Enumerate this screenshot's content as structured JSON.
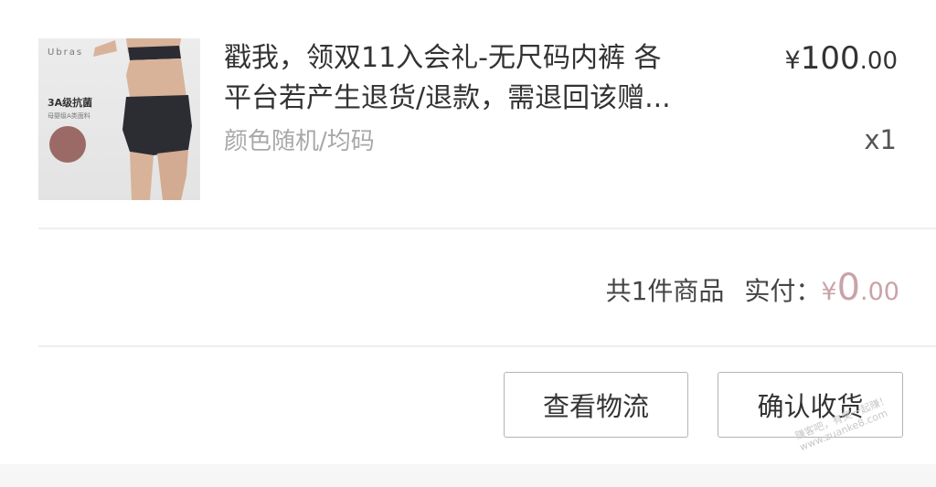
{
  "product": {
    "image": {
      "brand": "Ubras",
      "tag": "3A级抗菌",
      "tag_sub": "母婴级A类面料"
    },
    "title_line1": "戳我，领双11入会礼-无尺码内裤 各",
    "title_line2": "平台若产生退货/退款，需退回该赠...",
    "variant": "颜色随机/均码",
    "price": {
      "currency": "¥",
      "integer": "100",
      "decimal": ".00"
    },
    "quantity": "x1"
  },
  "summary": {
    "count_text": "共1件商品",
    "paid_label": "实付：",
    "amount": {
      "currency": "¥",
      "integer": "0",
      "decimal": ".00"
    }
  },
  "actions": {
    "logistics_label": "查看物流",
    "confirm_label": "确认收货"
  },
  "watermark": {
    "line1": "赚客吧，有奖一起赚！",
    "line2": "www.zuanke8.com"
  },
  "colors": {
    "amount": "#c9a3a8",
    "text": "#333333",
    "muted": "#a8a8a8",
    "page_bg": "#f6f6f6"
  }
}
